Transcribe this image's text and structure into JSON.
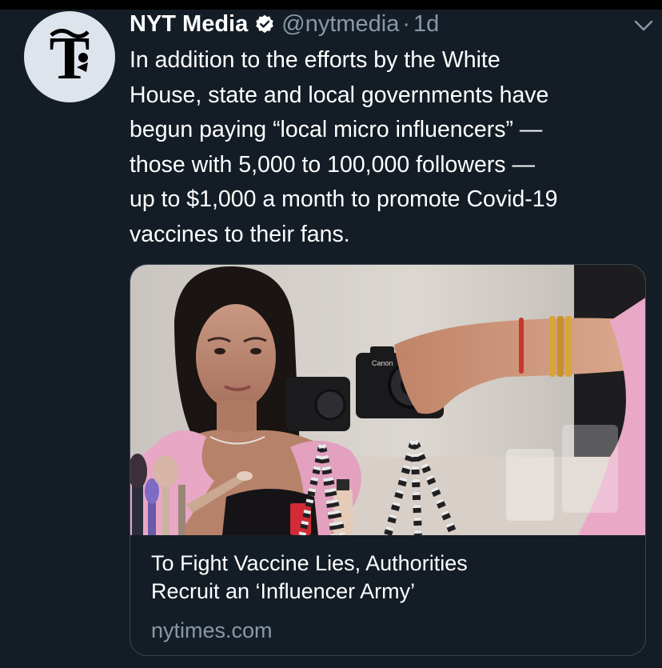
{
  "tweet": {
    "display_name": "NYT Media",
    "handle": "@nytmedia",
    "separator": "·",
    "time_ago": "1d",
    "verified_icon": "verified-badge-icon",
    "menu_icon": "chevron-down-icon",
    "text_lines": [
      "In addition to the efforts by the White",
      "House, state and local governments have",
      "begun paying “local micro influencers” —",
      "those with 5,000 to 100,000 followers —",
      "up to $1,000 a month to promote Covid-19",
      "vaccines to their fans."
    ]
  },
  "link_card": {
    "title_lines": [
      "To Fight Vaccine Lies, Authorities",
      "Recruit an ‘Influencer Army’"
    ],
    "domain": "nytimes.com",
    "camera_brand": "Canon"
  },
  "colors": {
    "background": "#141d26",
    "primary_text": "#ffffff",
    "secondary_text": "#8899a6",
    "card_border": "#38444d",
    "avatar_bg": "#dde4ec"
  }
}
